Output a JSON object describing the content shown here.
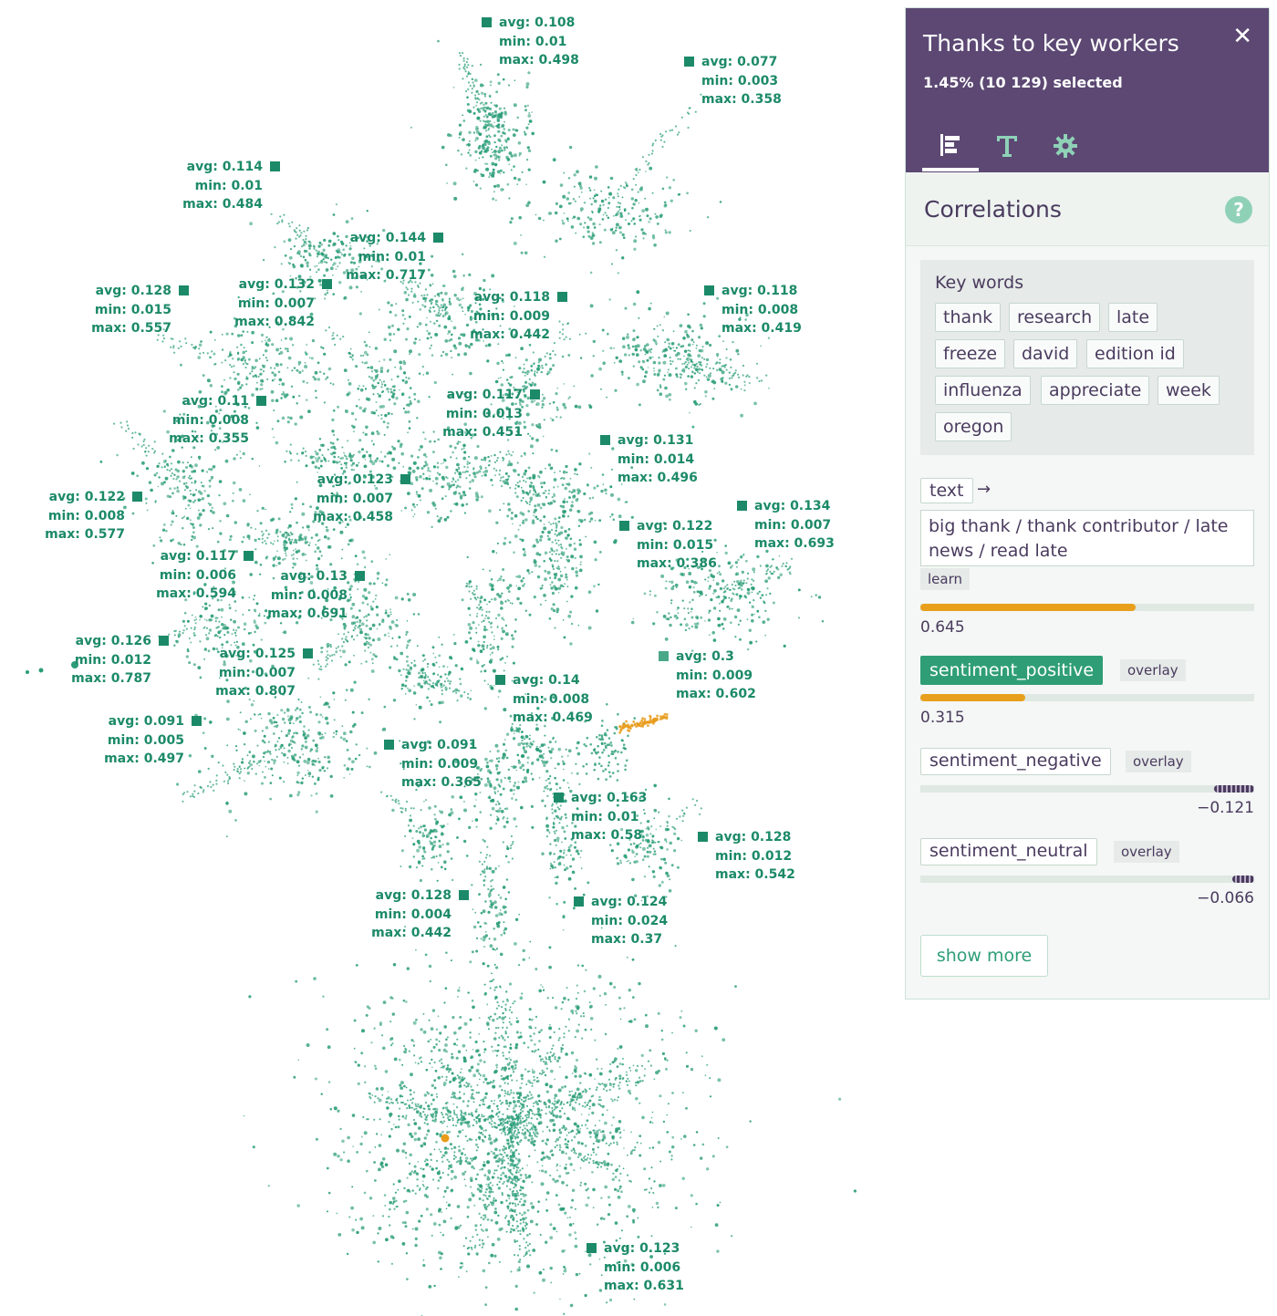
{
  "graph": {
    "node_color": "#2a9d78",
    "selected_color": "#e89b1a",
    "cluster_labels": [
      {
        "avg": "avg: 0.108",
        "min": "min: 0.01",
        "max": "max: 0.498"
      },
      {
        "avg": "avg: 0.077",
        "min": "min: 0.003",
        "max": "max: 0.358"
      },
      {
        "avg": "avg: 0.114",
        "min": "min: 0.01",
        "max": "max: 0.484"
      },
      {
        "avg": "avg: 0.144",
        "min": "min: 0.01",
        "max": "max: 0.717"
      },
      {
        "avg": "avg: 0.128",
        "min": "min: 0.015",
        "max": "max: 0.557"
      },
      {
        "avg": "avg: 0.132",
        "min": "min: 0.007",
        "max": "max: 0.842"
      },
      {
        "avg": "avg: 0.118",
        "min": "min: 0.009",
        "max": "max: 0.442"
      },
      {
        "avg": "avg: 0.118",
        "min": "min: 0.008",
        "max": "max: 0.419"
      },
      {
        "avg": "avg: 0.11",
        "min": "min: 0.008",
        "max": "max: 0.355"
      },
      {
        "avg": "avg: 0.117",
        "min": "min: 0.013",
        "max": "max: 0.451"
      },
      {
        "avg": "avg: 0.131",
        "min": "min: 0.014",
        "max": "max: 0.496"
      },
      {
        "avg": "avg: 0.122",
        "min": "min: 0.008",
        "max": "max: 0.577"
      },
      {
        "avg": "avg: 0.123",
        "min": "min: 0.007",
        "max": "max: 0.458"
      },
      {
        "avg": "avg: 0.134",
        "min": "min: 0.007",
        "max": "max: 0.693"
      },
      {
        "avg": "avg: 0.122",
        "min": "min: 0.015",
        "max": "max: 0.386"
      },
      {
        "avg": "avg: 0.117",
        "min": "min: 0.006",
        "max": "max: 0.594"
      },
      {
        "avg": "avg: 0.13",
        "min": "min: 0.008",
        "max": "max: 0.691"
      },
      {
        "avg": "avg: 0.126",
        "min": "min: 0.012",
        "max": "max: 0.787"
      },
      {
        "avg": "avg: 0.125",
        "min": "min: 0.007",
        "max": "max: 0.807"
      },
      {
        "avg": "avg: 0.3",
        "min": "min: 0.009",
        "max": "max: 0.602"
      },
      {
        "avg": "avg: 0.14",
        "min": "min: 0.008",
        "max": "max: 0.469"
      },
      {
        "avg": "avg: 0.091",
        "min": "min: 0.005",
        "max": "max: 0.497"
      },
      {
        "avg": "avg: 0.091",
        "min": "min: 0.009",
        "max": "max: 0.365"
      },
      {
        "avg": "avg: 0.163",
        "min": "min: 0.01",
        "max": "max: 0.58"
      },
      {
        "avg": "avg: 0.128",
        "min": "min: 0.012",
        "max": "max: 0.542"
      },
      {
        "avg": "avg: 0.128",
        "min": "min: 0.004",
        "max": "max: 0.442"
      },
      {
        "avg": "avg: 0.124",
        "min": "min: 0.024",
        "max": "max: 0.37"
      },
      {
        "avg": "avg: 0.123",
        "min": "min: 0.006",
        "max": "max: 0.631"
      }
    ]
  },
  "panel": {
    "title": "Thanks to key workers",
    "subtitle": "1.45% (10 129) selected",
    "close_icon": "close-icon",
    "tabs": [
      {
        "icon": "bar-chart-icon",
        "active": true
      },
      {
        "icon": "text-icon",
        "active": false
      },
      {
        "icon": "gear-icon",
        "active": false
      }
    ],
    "section_title": "Correlations",
    "help_label": "?",
    "keywords_title": "Key words",
    "keywords": [
      "thank",
      "research",
      "late",
      "freeze",
      "david",
      "edition id",
      "influenza",
      "appreciate",
      "week",
      "oregon"
    ],
    "text_field": {
      "label": "text",
      "value": "big thank / thank contributor / late news / read late",
      "tag": "learn",
      "score": 0.645,
      "score_label": "0.645"
    },
    "correlations": [
      {
        "label": "sentiment_positive",
        "tag": "overlay",
        "score": 0.315,
        "score_label": "0.315",
        "highlighted": true
      },
      {
        "label": "sentiment_negative",
        "tag": "overlay",
        "score": -0.121,
        "score_label": "−0.121",
        "highlighted": false
      },
      {
        "label": "sentiment_neutral",
        "tag": "overlay",
        "score": -0.066,
        "score_label": "−0.066",
        "highlighted": false
      }
    ],
    "show_more_label": "show more",
    "accent_color": "#2f9e77",
    "header_color": "#5c4873",
    "bar_color": "#e8a01c"
  }
}
